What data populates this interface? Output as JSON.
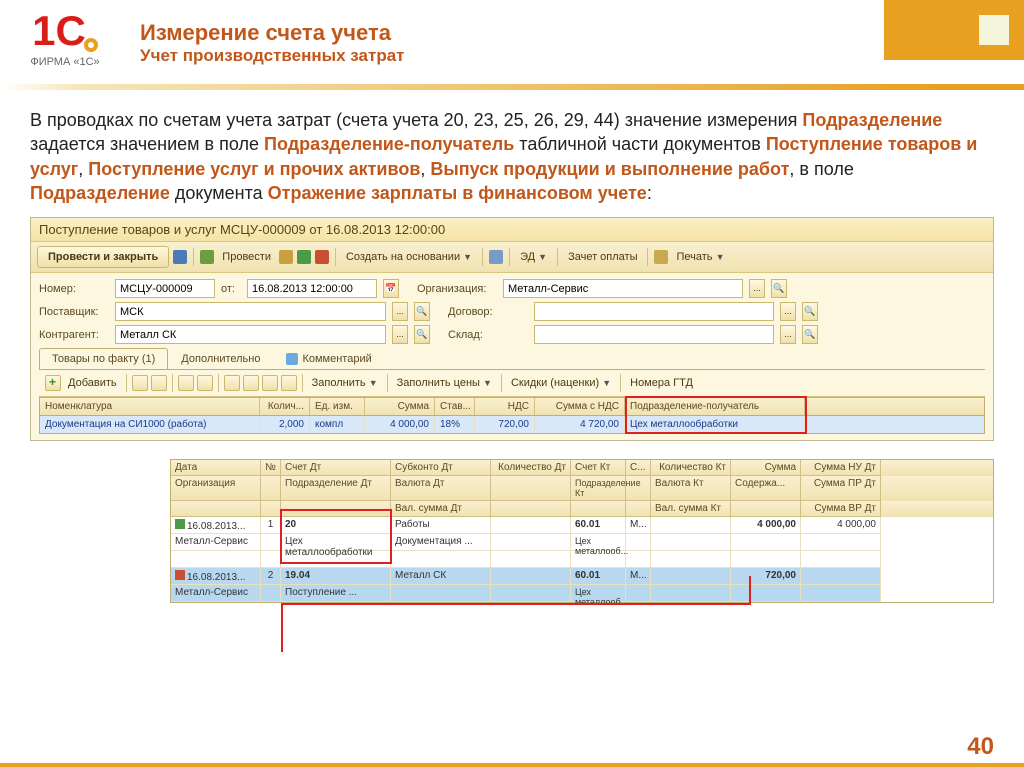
{
  "logo": {
    "firm": "ФИРМА «1С»"
  },
  "title": {
    "main": "Измерение счета учета",
    "sub": "Учет производственных затрат"
  },
  "para": {
    "t1": "В проводках по счетам учета затрат (счета учета 20, 23, 25, 26, 29, 44) значение измерения ",
    "h1": "Подразделение ",
    "t2": "задается значением в поле ",
    "h2": "Подразделение-получатель ",
    "t3": "табличной части документов ",
    "h3": "Поступление товаров и услуг",
    "t4": ", ",
    "h4": "Поступление услуг и прочих активов",
    "t5": ", ",
    "h5": "Выпуск продукции и выполнение работ",
    "t6": ", в поле ",
    "h6": "Подразделение ",
    "t7": "документа ",
    "h7": "Отражение зарплаты в финансовом учете",
    "t8": ":"
  },
  "win": {
    "title": "Поступление товаров и услуг МСЦУ-000009 от 16.08.2013 12:00:00"
  },
  "tb": {
    "post_close": "Провести и закрыть",
    "post": "Провести",
    "create": "Создать на основании",
    "ed": "ЭД",
    "offset": "Зачет оплаты",
    "print": "Печать"
  },
  "form": {
    "num_label": "Номер:",
    "num": "МСЦУ-000009",
    "date_label": "от:",
    "date": "16.08.2013 12:00:00",
    "org_label": "Организация:",
    "org": "Металл-Сервис",
    "supplier_label": "Поставщик:",
    "supplier": "МСК",
    "contract_label": "Договор:",
    "contract": "",
    "counter_label": "Контрагент:",
    "counter": "Металл СК",
    "wh_label": "Склад:",
    "wh": ""
  },
  "tabs": {
    "t1": "Товары по факту (1)",
    "t2": "Дополнительно",
    "t3": "Комментарий"
  },
  "subtb": {
    "add": "Добавить",
    "fill": "Заполнить",
    "fill_prices": "Заполнить цены",
    "disc": "Скидки (наценки)",
    "gtd": "Номера ГТД"
  },
  "gridh": {
    "c1": "Номенклатура",
    "c2": "Колич...",
    "c3": "Ед. изм.",
    "c4": "Сумма",
    "c5": "Став...",
    "c6": "НДС",
    "c7": "Сумма с НДС",
    "c8": "Подразделение-получатель"
  },
  "gridr": {
    "c1": "Документация на СИ1000 (работа)",
    "c2": "2,000",
    "c3": "компл",
    "c4": "4 000,00",
    "c5": "18%",
    "c6": "720,00",
    "c7": "4 720,00",
    "c8": "Цех металлообработки"
  },
  "lh": {
    "date": "Дата",
    "n": "№",
    "acc_dt": "Счет Дт",
    "sub_dt": "Субконто Дт",
    "qty_dt": "Количество Дт",
    "acc_kt": "Счет Кт",
    "s": "С...",
    "qty_kt": "Количество Кт",
    "sum": "Сумма",
    "sum_nu": "Сумма НУ Дт",
    "org": "Организация",
    "div_dt": "Подразделение Дт",
    "cur_dt": "Валюта Дт",
    "div_kt": "Подразделение Кт",
    "cur_kt": "Валюта Кт",
    "content": "Содержа...",
    "sum_pr": "Сумма ПР Дт",
    "val_dt": "Вал. сумма Дт",
    "val_kt": "Вал. сумма Кт",
    "sum_vr": "Сумма ВР Дт"
  },
  "lr1": {
    "date": "16.08.2013...",
    "n": "1",
    "acc_dt": "20",
    "sub_dt": "Работы",
    "acc_kt": "60.01",
    "s": "М...",
    "sum": "4 000,00",
    "sum_nu": "4 000,00",
    "org": "Металл-Сервис",
    "div_dt": "Цех металлообработки",
    "sub_dt2": "Документация ...",
    "div_kt": "Цех металлооб..."
  },
  "lr2": {
    "date": "16.08.2013...",
    "n": "2",
    "acc_dt": "19.04",
    "sub_dt": "Металл СК",
    "acc_kt": "60.01",
    "s": "М...",
    "sum": "720,00",
    "org": "Металл-Сервис",
    "div_dt": "Поступление ...",
    "div_kt": "Цех металлооб..."
  },
  "page": "40"
}
